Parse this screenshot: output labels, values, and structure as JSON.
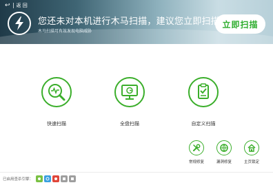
{
  "header": {
    "back_label": "返 回",
    "headline": "您还未对本机进行木马扫描，建议您立即扫描",
    "subline": "木马扫描可有效发现电脑威胁",
    "scan_now_label": "立即扫描"
  },
  "scan_options": [
    {
      "label": "快速扫描",
      "icon": "quick-scan-icon"
    },
    {
      "label": "全盘扫描",
      "icon": "full-scan-icon"
    },
    {
      "label": "自定义扫描",
      "icon": "custom-scan-icon"
    }
  ],
  "tools": [
    {
      "label": "常规修复",
      "icon": "wrench-icon"
    },
    {
      "label": "漏洞修复",
      "icon": "globe-repair-icon"
    },
    {
      "label": "主页锁定",
      "icon": "home-lock-icon"
    }
  ],
  "footer": {
    "engines_label": "已启用查杀引擎：",
    "engines": [
      {
        "name": "engine-1-icon",
        "color": "#7ac143"
      },
      {
        "name": "engine-2-icon",
        "color": "#3aa0e0"
      },
      {
        "name": "engine-3-icon",
        "color": "#e0463a"
      },
      {
        "name": "engine-4-icon",
        "color": "#9e9e9e"
      },
      {
        "name": "engine-5-icon",
        "color": "#9e9e9e"
      }
    ]
  },
  "colors": {
    "accent": "#3aae2a",
    "header_dark": "#1f3a48"
  }
}
